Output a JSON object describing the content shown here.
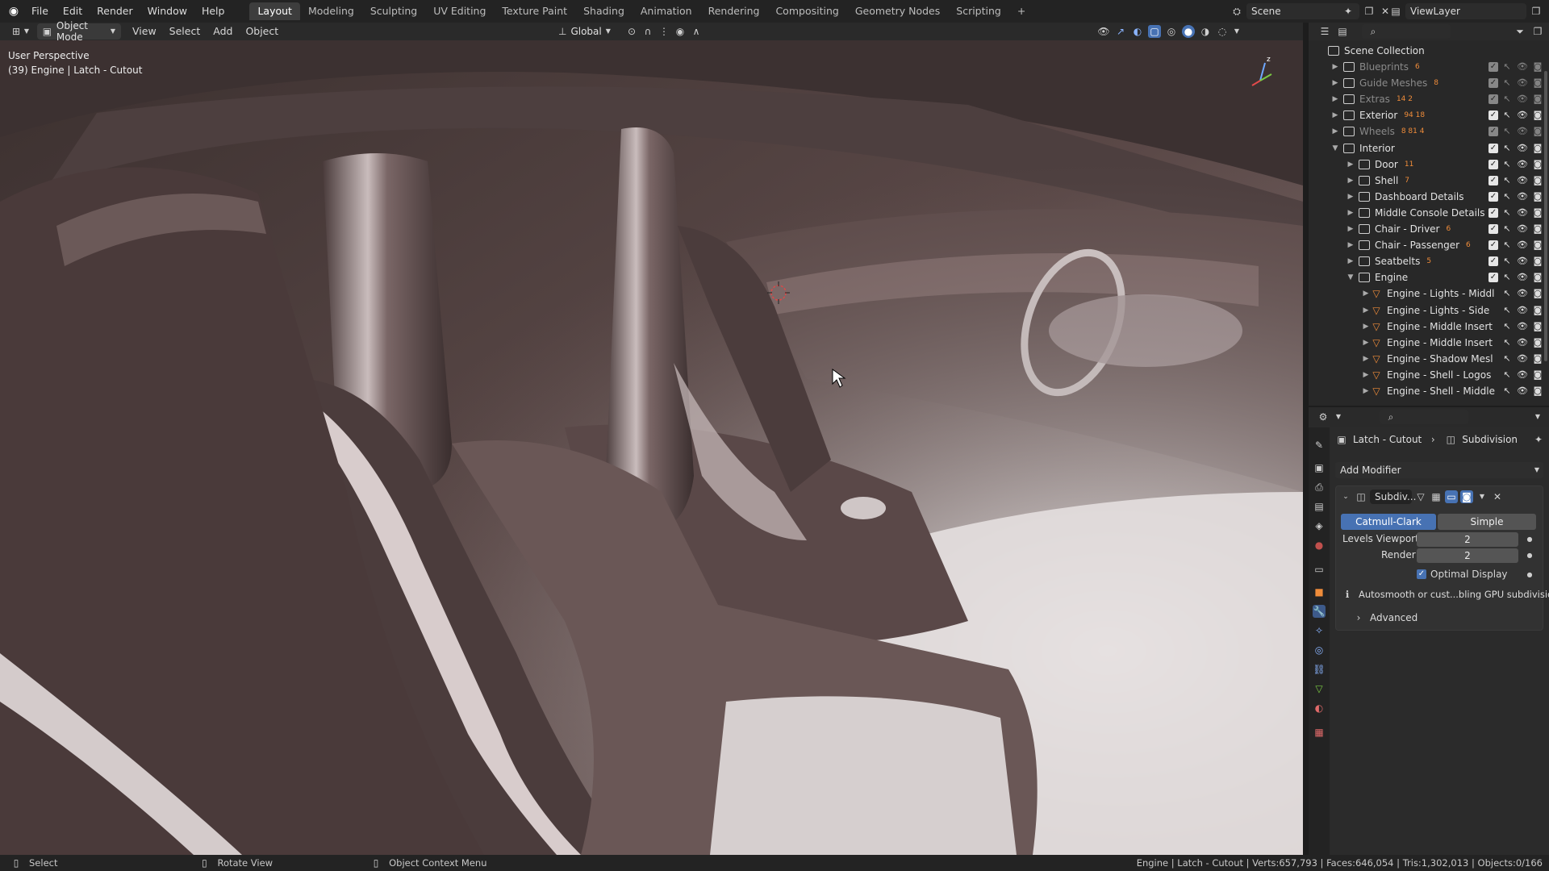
{
  "menu": [
    "File",
    "Edit",
    "Render",
    "Window",
    "Help"
  ],
  "workspaces": [
    {
      "label": "Layout",
      "active": true
    },
    {
      "label": "Modeling",
      "active": false
    },
    {
      "label": "Sculpting",
      "active": false
    },
    {
      "label": "UV Editing",
      "active": false
    },
    {
      "label": "Texture Paint",
      "active": false
    },
    {
      "label": "Shading",
      "active": false
    },
    {
      "label": "Animation",
      "active": false
    },
    {
      "label": "Rendering",
      "active": false
    },
    {
      "label": "Compositing",
      "active": false
    },
    {
      "label": "Geometry Nodes",
      "active": false
    },
    {
      "label": "Scripting",
      "active": false
    }
  ],
  "add_tab": "+",
  "scene": {
    "name": "Scene"
  },
  "view_layer": {
    "name": "ViewLayer"
  },
  "viewport_header": {
    "mode": "Object Mode",
    "view": "View",
    "select": "Select",
    "add": "Add",
    "object": "Object",
    "transform": "Global"
  },
  "viewport": {
    "perspective": "User Perspective",
    "info": "(39) Engine | Latch - Cutout"
  },
  "outliner": {
    "root": "Scene Collection",
    "rows": [
      {
        "label": "Blueprints",
        "indent": 1,
        "type": "collection",
        "dim": true,
        "badge": "6",
        "expanded": false
      },
      {
        "label": "Guide Meshes",
        "indent": 1,
        "type": "collection",
        "dim": true,
        "badge": "8",
        "expanded": false
      },
      {
        "label": "Extras",
        "indent": 1,
        "type": "collection",
        "dim": true,
        "badge": "14  2",
        "expanded": false
      },
      {
        "label": "Exterior",
        "indent": 1,
        "type": "collection",
        "dim": false,
        "badge": "94  18",
        "expanded": false
      },
      {
        "label": "Wheels",
        "indent": 1,
        "type": "collection",
        "dim": true,
        "badge": "8  81  4",
        "expanded": false
      },
      {
        "label": "Interior",
        "indent": 1,
        "type": "collection",
        "dim": false,
        "badge": "",
        "expanded": true
      },
      {
        "label": "Door",
        "indent": 2,
        "type": "collection",
        "dim": false,
        "badge": "11",
        "expanded": false
      },
      {
        "label": "Shell",
        "indent": 2,
        "type": "collection",
        "dim": false,
        "badge": "7",
        "expanded": false
      },
      {
        "label": "Dashboard Details",
        "indent": 2,
        "type": "collection",
        "dim": false,
        "badge": "",
        "expanded": false
      },
      {
        "label": "Middle Console Details",
        "indent": 2,
        "type": "collection",
        "dim": false,
        "badge": "",
        "expanded": false
      },
      {
        "label": "Chair - Driver",
        "indent": 2,
        "type": "collection",
        "dim": false,
        "badge": "6",
        "expanded": false
      },
      {
        "label": "Chair - Passenger",
        "indent": 2,
        "type": "collection",
        "dim": false,
        "badge": "6",
        "expanded": false
      },
      {
        "label": "Seatbelts",
        "indent": 2,
        "type": "collection",
        "dim": false,
        "badge": "5",
        "expanded": false
      },
      {
        "label": "Engine",
        "indent": 2,
        "type": "collection",
        "dim": false,
        "badge": "",
        "expanded": true
      },
      {
        "label": "Engine - Lights - Middl",
        "indent": 3,
        "type": "mesh",
        "dim": false,
        "badge": "",
        "expanded": false
      },
      {
        "label": "Engine - Lights - Side",
        "indent": 3,
        "type": "mesh",
        "dim": false,
        "badge": "",
        "expanded": false
      },
      {
        "label": "Engine - Middle Insert",
        "indent": 3,
        "type": "mesh",
        "dim": false,
        "badge": "",
        "expanded": false
      },
      {
        "label": "Engine - Middle Insert",
        "indent": 3,
        "type": "mesh",
        "dim": false,
        "badge": "",
        "expanded": false
      },
      {
        "label": "Engine - Shadow Mesl",
        "indent": 3,
        "type": "mesh",
        "dim": false,
        "badge": "",
        "expanded": false
      },
      {
        "label": "Engine - Shell - Logos",
        "indent": 3,
        "type": "mesh",
        "dim": false,
        "badge": "",
        "expanded": false
      },
      {
        "label": "Engine - Shell - Middle",
        "indent": 3,
        "type": "mesh",
        "dim": false,
        "badge": "",
        "expanded": false
      }
    ]
  },
  "properties": {
    "object": "Latch - Cutout",
    "modifier": "Subdivision",
    "add_modifier": "Add Modifier",
    "mod_name": "Subdiv...",
    "catmull": "Catmull-Clark",
    "simple": "Simple",
    "levels_label": "Levels Viewport",
    "levels_value": "2",
    "render_label": "Render",
    "render_value": "2",
    "optimal": "Optimal Display",
    "notice": "Autosmooth or cust...bling GPU subdivision",
    "advanced": "Advanced"
  },
  "status": {
    "select": "Select",
    "rotate": "Rotate View",
    "context": "Object Context Menu",
    "stats": "Engine | Latch - Cutout | Verts:657,793 | Faces:646,054 | Tris:1,302,013 | Objects:0/166"
  },
  "colors": {
    "accent": "#4772b3",
    "mesh_orange": "#ef8c3a"
  }
}
